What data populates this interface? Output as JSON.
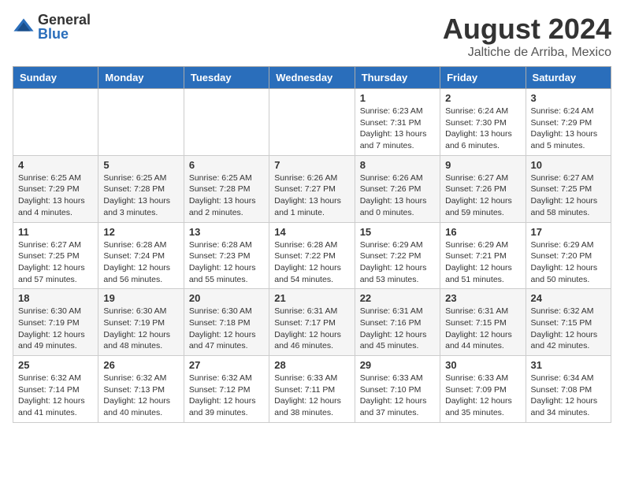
{
  "logo": {
    "general": "General",
    "blue": "Blue"
  },
  "title": "August 2024",
  "location": "Jaltiche de Arriba, Mexico",
  "days_header": [
    "Sunday",
    "Monday",
    "Tuesday",
    "Wednesday",
    "Thursday",
    "Friday",
    "Saturday"
  ],
  "weeks": [
    [
      {
        "day": "",
        "info": ""
      },
      {
        "day": "",
        "info": ""
      },
      {
        "day": "",
        "info": ""
      },
      {
        "day": "",
        "info": ""
      },
      {
        "day": "1",
        "info": "Sunrise: 6:23 AM\nSunset: 7:31 PM\nDaylight: 13 hours and 7 minutes."
      },
      {
        "day": "2",
        "info": "Sunrise: 6:24 AM\nSunset: 7:30 PM\nDaylight: 13 hours and 6 minutes."
      },
      {
        "day": "3",
        "info": "Sunrise: 6:24 AM\nSunset: 7:29 PM\nDaylight: 13 hours and 5 minutes."
      }
    ],
    [
      {
        "day": "4",
        "info": "Sunrise: 6:25 AM\nSunset: 7:29 PM\nDaylight: 13 hours and 4 minutes."
      },
      {
        "day": "5",
        "info": "Sunrise: 6:25 AM\nSunset: 7:28 PM\nDaylight: 13 hours and 3 minutes."
      },
      {
        "day": "6",
        "info": "Sunrise: 6:25 AM\nSunset: 7:28 PM\nDaylight: 13 hours and 2 minutes."
      },
      {
        "day": "7",
        "info": "Sunrise: 6:26 AM\nSunset: 7:27 PM\nDaylight: 13 hours and 1 minute."
      },
      {
        "day": "8",
        "info": "Sunrise: 6:26 AM\nSunset: 7:26 PM\nDaylight: 13 hours and 0 minutes."
      },
      {
        "day": "9",
        "info": "Sunrise: 6:27 AM\nSunset: 7:26 PM\nDaylight: 12 hours and 59 minutes."
      },
      {
        "day": "10",
        "info": "Sunrise: 6:27 AM\nSunset: 7:25 PM\nDaylight: 12 hours and 58 minutes."
      }
    ],
    [
      {
        "day": "11",
        "info": "Sunrise: 6:27 AM\nSunset: 7:25 PM\nDaylight: 12 hours and 57 minutes."
      },
      {
        "day": "12",
        "info": "Sunrise: 6:28 AM\nSunset: 7:24 PM\nDaylight: 12 hours and 56 minutes."
      },
      {
        "day": "13",
        "info": "Sunrise: 6:28 AM\nSunset: 7:23 PM\nDaylight: 12 hours and 55 minutes."
      },
      {
        "day": "14",
        "info": "Sunrise: 6:28 AM\nSunset: 7:22 PM\nDaylight: 12 hours and 54 minutes."
      },
      {
        "day": "15",
        "info": "Sunrise: 6:29 AM\nSunset: 7:22 PM\nDaylight: 12 hours and 53 minutes."
      },
      {
        "day": "16",
        "info": "Sunrise: 6:29 AM\nSunset: 7:21 PM\nDaylight: 12 hours and 51 minutes."
      },
      {
        "day": "17",
        "info": "Sunrise: 6:29 AM\nSunset: 7:20 PM\nDaylight: 12 hours and 50 minutes."
      }
    ],
    [
      {
        "day": "18",
        "info": "Sunrise: 6:30 AM\nSunset: 7:19 PM\nDaylight: 12 hours and 49 minutes."
      },
      {
        "day": "19",
        "info": "Sunrise: 6:30 AM\nSunset: 7:19 PM\nDaylight: 12 hours and 48 minutes."
      },
      {
        "day": "20",
        "info": "Sunrise: 6:30 AM\nSunset: 7:18 PM\nDaylight: 12 hours and 47 minutes."
      },
      {
        "day": "21",
        "info": "Sunrise: 6:31 AM\nSunset: 7:17 PM\nDaylight: 12 hours and 46 minutes."
      },
      {
        "day": "22",
        "info": "Sunrise: 6:31 AM\nSunset: 7:16 PM\nDaylight: 12 hours and 45 minutes."
      },
      {
        "day": "23",
        "info": "Sunrise: 6:31 AM\nSunset: 7:15 PM\nDaylight: 12 hours and 44 minutes."
      },
      {
        "day": "24",
        "info": "Sunrise: 6:32 AM\nSunset: 7:15 PM\nDaylight: 12 hours and 42 minutes."
      }
    ],
    [
      {
        "day": "25",
        "info": "Sunrise: 6:32 AM\nSunset: 7:14 PM\nDaylight: 12 hours and 41 minutes."
      },
      {
        "day": "26",
        "info": "Sunrise: 6:32 AM\nSunset: 7:13 PM\nDaylight: 12 hours and 40 minutes."
      },
      {
        "day": "27",
        "info": "Sunrise: 6:32 AM\nSunset: 7:12 PM\nDaylight: 12 hours and 39 minutes."
      },
      {
        "day": "28",
        "info": "Sunrise: 6:33 AM\nSunset: 7:11 PM\nDaylight: 12 hours and 38 minutes."
      },
      {
        "day": "29",
        "info": "Sunrise: 6:33 AM\nSunset: 7:10 PM\nDaylight: 12 hours and 37 minutes."
      },
      {
        "day": "30",
        "info": "Sunrise: 6:33 AM\nSunset: 7:09 PM\nDaylight: 12 hours and 35 minutes."
      },
      {
        "day": "31",
        "info": "Sunrise: 6:34 AM\nSunset: 7:08 PM\nDaylight: 12 hours and 34 minutes."
      }
    ]
  ]
}
